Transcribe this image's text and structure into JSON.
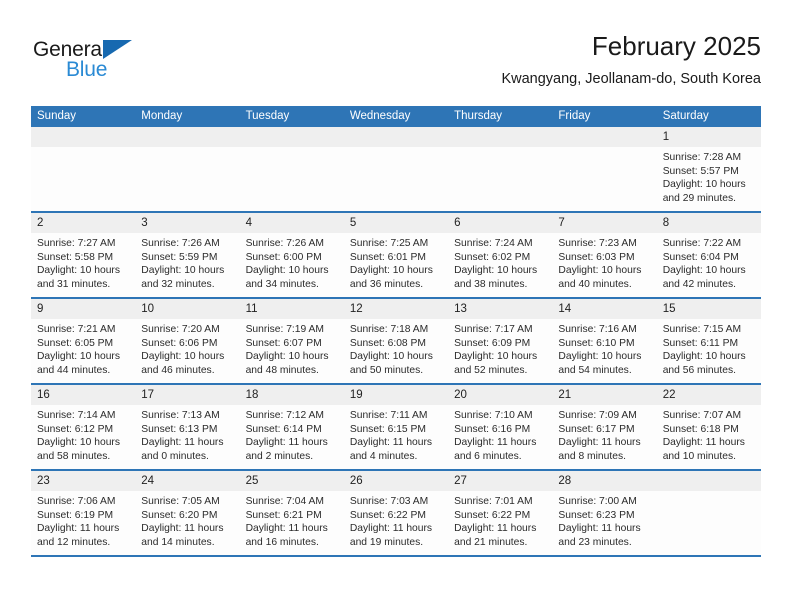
{
  "brand": {
    "name_top": "General",
    "name_bottom": "Blue",
    "triangle_icon": "blue-triangle-logo-mark",
    "accent_color": "#2a8ad4",
    "mark_color": "#1769b0"
  },
  "header": {
    "title": "February 2025",
    "subtitle": "Kwangyang, Jeollanam-do, South Korea"
  },
  "colors": {
    "header_bg": "#2e75b6",
    "header_text": "#ffffff",
    "daynum_bg": "#efefef",
    "cell_bg": "#fdfdfd",
    "row_border": "#2e75b6"
  },
  "weekdays": [
    "Sunday",
    "Monday",
    "Tuesday",
    "Wednesday",
    "Thursday",
    "Friday",
    "Saturday"
  ],
  "weeks": [
    [
      {
        "day": "",
        "lines": []
      },
      {
        "day": "",
        "lines": []
      },
      {
        "day": "",
        "lines": []
      },
      {
        "day": "",
        "lines": []
      },
      {
        "day": "",
        "lines": []
      },
      {
        "day": "",
        "lines": []
      },
      {
        "day": "1",
        "lines": [
          "Sunrise: 7:28 AM",
          "Sunset: 5:57 PM",
          "Daylight: 10 hours",
          "and 29 minutes."
        ]
      }
    ],
    [
      {
        "day": "2",
        "lines": [
          "Sunrise: 7:27 AM",
          "Sunset: 5:58 PM",
          "Daylight: 10 hours",
          "and 31 minutes."
        ]
      },
      {
        "day": "3",
        "lines": [
          "Sunrise: 7:26 AM",
          "Sunset: 5:59 PM",
          "Daylight: 10 hours",
          "and 32 minutes."
        ]
      },
      {
        "day": "4",
        "lines": [
          "Sunrise: 7:26 AM",
          "Sunset: 6:00 PM",
          "Daylight: 10 hours",
          "and 34 minutes."
        ]
      },
      {
        "day": "5",
        "lines": [
          "Sunrise: 7:25 AM",
          "Sunset: 6:01 PM",
          "Daylight: 10 hours",
          "and 36 minutes."
        ]
      },
      {
        "day": "6",
        "lines": [
          "Sunrise: 7:24 AM",
          "Sunset: 6:02 PM",
          "Daylight: 10 hours",
          "and 38 minutes."
        ]
      },
      {
        "day": "7",
        "lines": [
          "Sunrise: 7:23 AM",
          "Sunset: 6:03 PM",
          "Daylight: 10 hours",
          "and 40 minutes."
        ]
      },
      {
        "day": "8",
        "lines": [
          "Sunrise: 7:22 AM",
          "Sunset: 6:04 PM",
          "Daylight: 10 hours",
          "and 42 minutes."
        ]
      }
    ],
    [
      {
        "day": "9",
        "lines": [
          "Sunrise: 7:21 AM",
          "Sunset: 6:05 PM",
          "Daylight: 10 hours",
          "and 44 minutes."
        ]
      },
      {
        "day": "10",
        "lines": [
          "Sunrise: 7:20 AM",
          "Sunset: 6:06 PM",
          "Daylight: 10 hours",
          "and 46 minutes."
        ]
      },
      {
        "day": "11",
        "lines": [
          "Sunrise: 7:19 AM",
          "Sunset: 6:07 PM",
          "Daylight: 10 hours",
          "and 48 minutes."
        ]
      },
      {
        "day": "12",
        "lines": [
          "Sunrise: 7:18 AM",
          "Sunset: 6:08 PM",
          "Daylight: 10 hours",
          "and 50 minutes."
        ]
      },
      {
        "day": "13",
        "lines": [
          "Sunrise: 7:17 AM",
          "Sunset: 6:09 PM",
          "Daylight: 10 hours",
          "and 52 minutes."
        ]
      },
      {
        "day": "14",
        "lines": [
          "Sunrise: 7:16 AM",
          "Sunset: 6:10 PM",
          "Daylight: 10 hours",
          "and 54 minutes."
        ]
      },
      {
        "day": "15",
        "lines": [
          "Sunrise: 7:15 AM",
          "Sunset: 6:11 PM",
          "Daylight: 10 hours",
          "and 56 minutes."
        ]
      }
    ],
    [
      {
        "day": "16",
        "lines": [
          "Sunrise: 7:14 AM",
          "Sunset: 6:12 PM",
          "Daylight: 10 hours",
          "and 58 minutes."
        ]
      },
      {
        "day": "17",
        "lines": [
          "Sunrise: 7:13 AM",
          "Sunset: 6:13 PM",
          "Daylight: 11 hours",
          "and 0 minutes."
        ]
      },
      {
        "day": "18",
        "lines": [
          "Sunrise: 7:12 AM",
          "Sunset: 6:14 PM",
          "Daylight: 11 hours",
          "and 2 minutes."
        ]
      },
      {
        "day": "19",
        "lines": [
          "Sunrise: 7:11 AM",
          "Sunset: 6:15 PM",
          "Daylight: 11 hours",
          "and 4 minutes."
        ]
      },
      {
        "day": "20",
        "lines": [
          "Sunrise: 7:10 AM",
          "Sunset: 6:16 PM",
          "Daylight: 11 hours",
          "and 6 minutes."
        ]
      },
      {
        "day": "21",
        "lines": [
          "Sunrise: 7:09 AM",
          "Sunset: 6:17 PM",
          "Daylight: 11 hours",
          "and 8 minutes."
        ]
      },
      {
        "day": "22",
        "lines": [
          "Sunrise: 7:07 AM",
          "Sunset: 6:18 PM",
          "Daylight: 11 hours",
          "and 10 minutes."
        ]
      }
    ],
    [
      {
        "day": "23",
        "lines": [
          "Sunrise: 7:06 AM",
          "Sunset: 6:19 PM",
          "Daylight: 11 hours",
          "and 12 minutes."
        ]
      },
      {
        "day": "24",
        "lines": [
          "Sunrise: 7:05 AM",
          "Sunset: 6:20 PM",
          "Daylight: 11 hours",
          "and 14 minutes."
        ]
      },
      {
        "day": "25",
        "lines": [
          "Sunrise: 7:04 AM",
          "Sunset: 6:21 PM",
          "Daylight: 11 hours",
          "and 16 minutes."
        ]
      },
      {
        "day": "26",
        "lines": [
          "Sunrise: 7:03 AM",
          "Sunset: 6:22 PM",
          "Daylight: 11 hours",
          "and 19 minutes."
        ]
      },
      {
        "day": "27",
        "lines": [
          "Sunrise: 7:01 AM",
          "Sunset: 6:22 PM",
          "Daylight: 11 hours",
          "and 21 minutes."
        ]
      },
      {
        "day": "28",
        "lines": [
          "Sunrise: 7:00 AM",
          "Sunset: 6:23 PM",
          "Daylight: 11 hours",
          "and 23 minutes."
        ]
      },
      {
        "day": "",
        "lines": []
      }
    ]
  ]
}
